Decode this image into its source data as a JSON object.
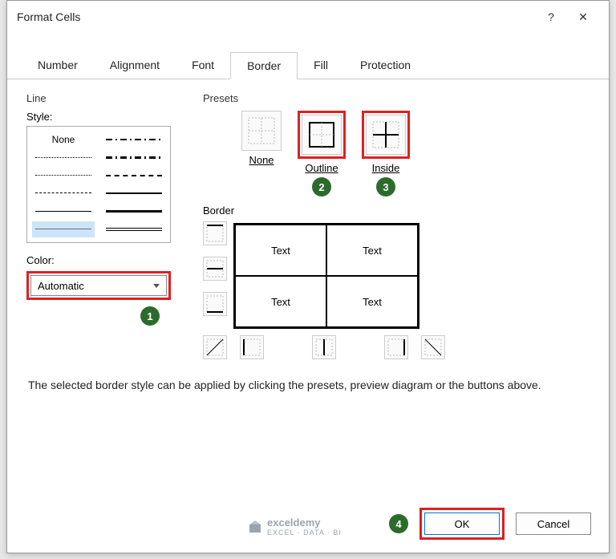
{
  "dialog": {
    "title": "Format Cells",
    "help_tooltip": "?",
    "close_tooltip": "✕"
  },
  "tabs": [
    "Number",
    "Alignment",
    "Font",
    "Border",
    "Fill",
    "Protection"
  ],
  "active_tab": "Border",
  "line": {
    "section": "Line",
    "style_label": "Style:",
    "none_text": "None",
    "color_label": "Color:",
    "color_value": "Automatic"
  },
  "presets": {
    "section": "Presets",
    "items": [
      {
        "label": "None"
      },
      {
        "label": "Outline"
      },
      {
        "label": "Inside"
      }
    ]
  },
  "border": {
    "section": "Border",
    "cell_text": "Text"
  },
  "description": "The selected border style can be applied by clicking the presets, preview diagram or the buttons above.",
  "buttons": {
    "ok": "OK",
    "cancel": "Cancel"
  },
  "watermark": {
    "name": "exceldemy",
    "sub": "EXCEL · DATA · BI"
  },
  "annotations": {
    "b1": "1",
    "b2": "2",
    "b3": "3",
    "b4": "4"
  }
}
